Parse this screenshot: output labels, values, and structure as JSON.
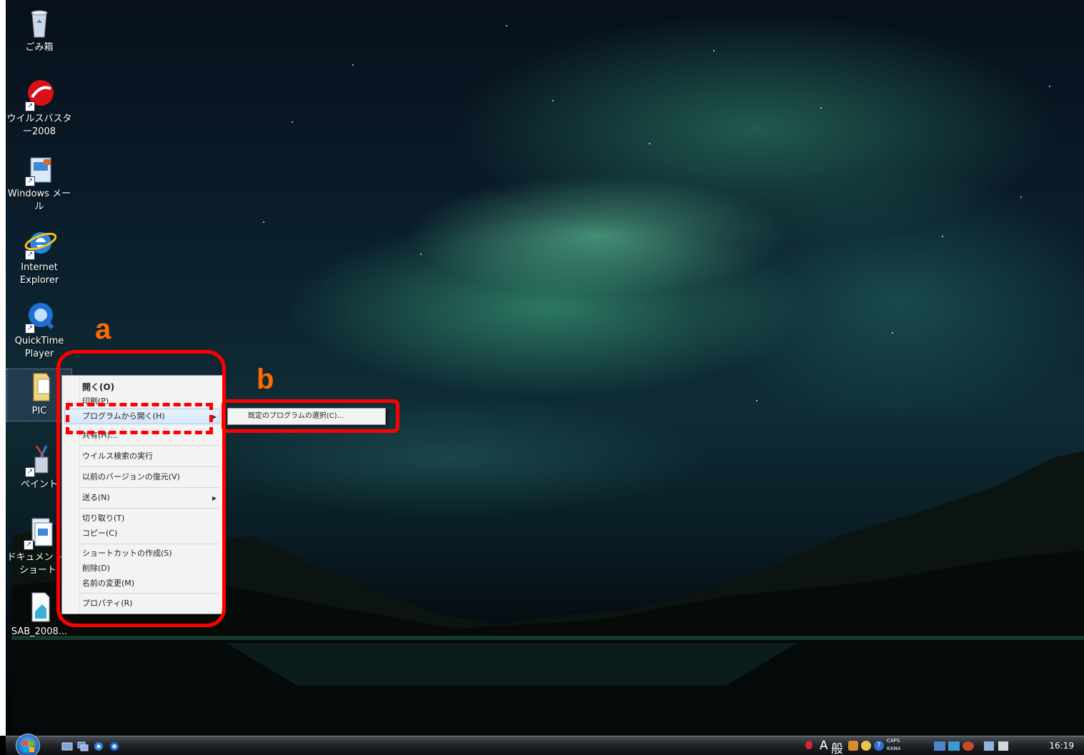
{
  "desktop": {
    "icons": [
      {
        "label": "ごみ箱",
        "icon": "recycle-bin-icon"
      },
      {
        "label": "ウイルスバスター2008",
        "icon": "virusbuster-icon"
      },
      {
        "label": "Windows メール",
        "icon": "windows-mail-icon"
      },
      {
        "label": "Internet Explorer",
        "icon": "internet-explorer-icon"
      },
      {
        "label": "QuickTime Player",
        "icon": "quicktime-icon"
      },
      {
        "label": "PIC",
        "icon": "folder-icon"
      },
      {
        "label": "ペイント",
        "icon": "paint-icon"
      },
      {
        "label": "ドキュメント - ショート",
        "icon": "documents-icon"
      },
      {
        "label": "SAB_2008...",
        "icon": "file-icon"
      }
    ]
  },
  "context_menu": {
    "items": {
      "open": "開く(O)",
      "print": "印刷(P)",
      "open_with": "プログラムから開く(H)",
      "share": "共有(H)...",
      "virus_scan": "ウイルス検索の実行",
      "restore": "以前のバージョンの復元(V)",
      "send_to": "送る(N)",
      "cut": "切り取り(T)",
      "copy": "コピー(C)",
      "shortcut": "ショートカットの作成(S)",
      "delete": "削除(D)",
      "rename": "名前の変更(M)",
      "properties": "プロパティ(R)"
    }
  },
  "submenu": {
    "item": "既定のプログラムの選択(C)..."
  },
  "annotations": {
    "a": "a",
    "b": "b"
  },
  "taskbar": {
    "clock": "16:19",
    "ime_mode": "A",
    "ime_label": "般",
    "caps": "CAPS",
    "kana": "KANA"
  },
  "colors": {
    "annotation_red": "#ff0000",
    "annotation_orange": "#ff6a00"
  }
}
